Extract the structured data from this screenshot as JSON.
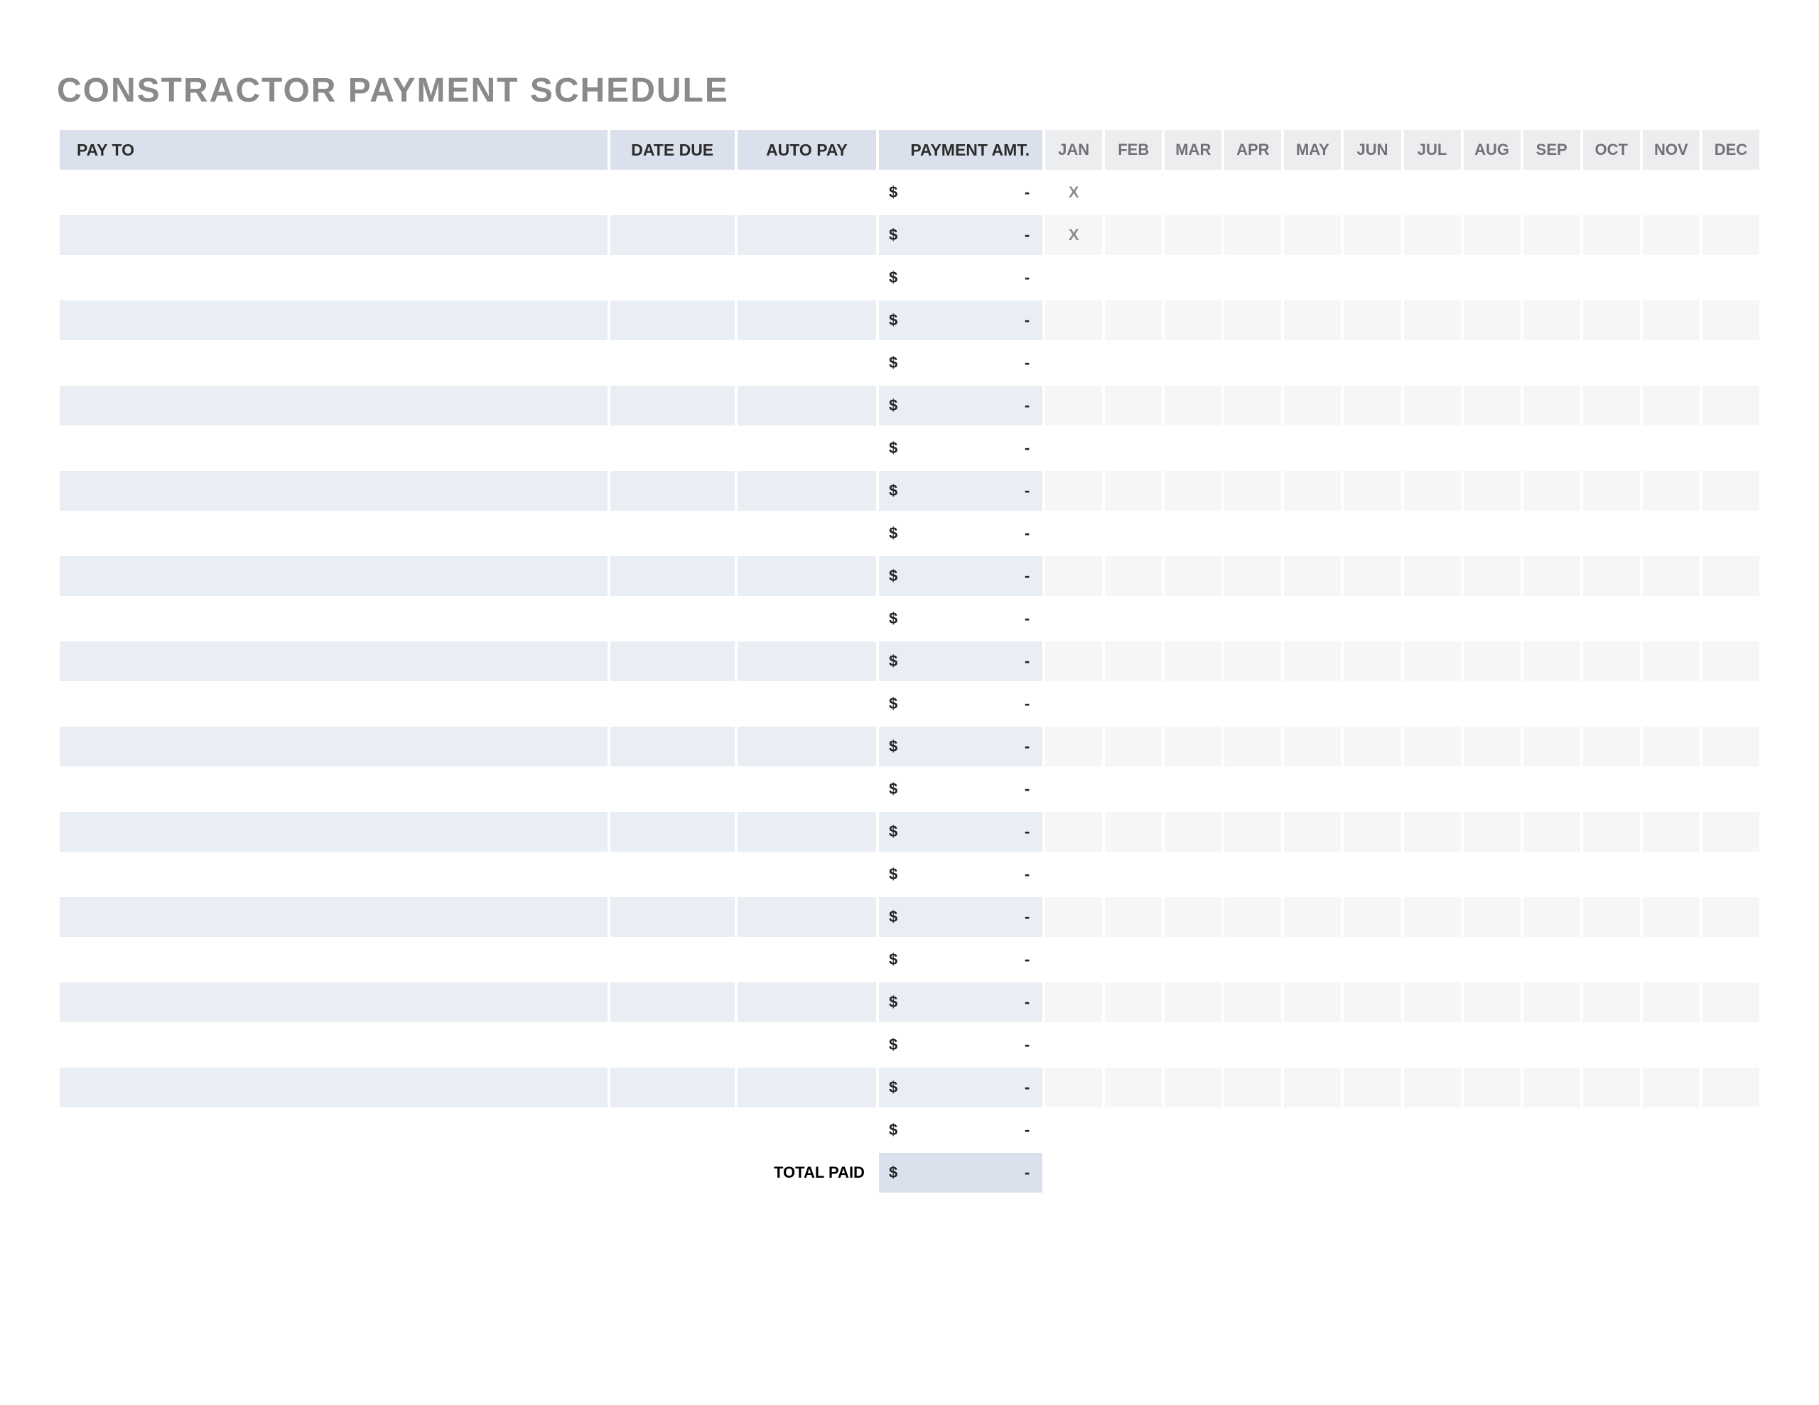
{
  "title": "CONSTRACTOR PAYMENT SCHEDULE",
  "headers": {
    "pay_to": "PAY TO",
    "date_due": "DATE DUE",
    "auto_pay": "AUTO PAY",
    "payment_amt": "PAYMENT AMT."
  },
  "months": [
    "JAN",
    "FEB",
    "MAR",
    "APR",
    "MAY",
    "JUN",
    "JUL",
    "AUG",
    "SEP",
    "OCT",
    "NOV",
    "DEC"
  ],
  "amt_currency": "$",
  "amt_placeholder": "-",
  "month_mark": "X",
  "total_label": "TOTAL PAID",
  "total_currency": "$",
  "total_value": "-",
  "rows": [
    {
      "pay_to": "",
      "date_due": "",
      "auto_pay": "",
      "amt": "-",
      "months": [
        "X",
        "",
        "",
        "",
        "",
        "",
        "",
        "",
        "",
        "",
        "",
        ""
      ]
    },
    {
      "pay_to": "",
      "date_due": "",
      "auto_pay": "",
      "amt": "-",
      "months": [
        "X",
        "",
        "",
        "",
        "",
        "",
        "",
        "",
        "",
        "",
        "",
        ""
      ]
    },
    {
      "pay_to": "",
      "date_due": "",
      "auto_pay": "",
      "amt": "-",
      "months": [
        "",
        "",
        "",
        "",
        "",
        "",
        "",
        "",
        "",
        "",
        "",
        ""
      ]
    },
    {
      "pay_to": "",
      "date_due": "",
      "auto_pay": "",
      "amt": "-",
      "months": [
        "",
        "",
        "",
        "",
        "",
        "",
        "",
        "",
        "",
        "",
        "",
        ""
      ]
    },
    {
      "pay_to": "",
      "date_due": "",
      "auto_pay": "",
      "amt": "-",
      "months": [
        "",
        "",
        "",
        "",
        "",
        "",
        "",
        "",
        "",
        "",
        "",
        ""
      ]
    },
    {
      "pay_to": "",
      "date_due": "",
      "auto_pay": "",
      "amt": "-",
      "months": [
        "",
        "",
        "",
        "",
        "",
        "",
        "",
        "",
        "",
        "",
        "",
        ""
      ]
    },
    {
      "pay_to": "",
      "date_due": "",
      "auto_pay": "",
      "amt": "-",
      "months": [
        "",
        "",
        "",
        "",
        "",
        "",
        "",
        "",
        "",
        "",
        "",
        ""
      ]
    },
    {
      "pay_to": "",
      "date_due": "",
      "auto_pay": "",
      "amt": "-",
      "months": [
        "",
        "",
        "",
        "",
        "",
        "",
        "",
        "",
        "",
        "",
        "",
        ""
      ]
    },
    {
      "pay_to": "",
      "date_due": "",
      "auto_pay": "",
      "amt": "-",
      "months": [
        "",
        "",
        "",
        "",
        "",
        "",
        "",
        "",
        "",
        "",
        "",
        ""
      ]
    },
    {
      "pay_to": "",
      "date_due": "",
      "auto_pay": "",
      "amt": "-",
      "months": [
        "",
        "",
        "",
        "",
        "",
        "",
        "",
        "",
        "",
        "",
        "",
        ""
      ]
    },
    {
      "pay_to": "",
      "date_due": "",
      "auto_pay": "",
      "amt": "-",
      "months": [
        "",
        "",
        "",
        "",
        "",
        "",
        "",
        "",
        "",
        "",
        "",
        ""
      ]
    },
    {
      "pay_to": "",
      "date_due": "",
      "auto_pay": "",
      "amt": "-",
      "months": [
        "",
        "",
        "",
        "",
        "",
        "",
        "",
        "",
        "",
        "",
        "",
        ""
      ]
    },
    {
      "pay_to": "",
      "date_due": "",
      "auto_pay": "",
      "amt": "-",
      "months": [
        "",
        "",
        "",
        "",
        "",
        "",
        "",
        "",
        "",
        "",
        "",
        ""
      ]
    },
    {
      "pay_to": "",
      "date_due": "",
      "auto_pay": "",
      "amt": "-",
      "months": [
        "",
        "",
        "",
        "",
        "",
        "",
        "",
        "",
        "",
        "",
        "",
        ""
      ]
    },
    {
      "pay_to": "",
      "date_due": "",
      "auto_pay": "",
      "amt": "-",
      "months": [
        "",
        "",
        "",
        "",
        "",
        "",
        "",
        "",
        "",
        "",
        "",
        ""
      ]
    },
    {
      "pay_to": "",
      "date_due": "",
      "auto_pay": "",
      "amt": "-",
      "months": [
        "",
        "",
        "",
        "",
        "",
        "",
        "",
        "",
        "",
        "",
        "",
        ""
      ]
    },
    {
      "pay_to": "",
      "date_due": "",
      "auto_pay": "",
      "amt": "-",
      "months": [
        "",
        "",
        "",
        "",
        "",
        "",
        "",
        "",
        "",
        "",
        "",
        ""
      ]
    },
    {
      "pay_to": "",
      "date_due": "",
      "auto_pay": "",
      "amt": "-",
      "months": [
        "",
        "",
        "",
        "",
        "",
        "",
        "",
        "",
        "",
        "",
        "",
        ""
      ]
    },
    {
      "pay_to": "",
      "date_due": "",
      "auto_pay": "",
      "amt": "-",
      "months": [
        "",
        "",
        "",
        "",
        "",
        "",
        "",
        "",
        "",
        "",
        "",
        ""
      ]
    },
    {
      "pay_to": "",
      "date_due": "",
      "auto_pay": "",
      "amt": "-",
      "months": [
        "",
        "",
        "",
        "",
        "",
        "",
        "",
        "",
        "",
        "",
        "",
        ""
      ]
    },
    {
      "pay_to": "",
      "date_due": "",
      "auto_pay": "",
      "amt": "-",
      "months": [
        "",
        "",
        "",
        "",
        "",
        "",
        "",
        "",
        "",
        "",
        "",
        ""
      ]
    },
    {
      "pay_to": "",
      "date_due": "",
      "auto_pay": "",
      "amt": "-",
      "months": [
        "",
        "",
        "",
        "",
        "",
        "",
        "",
        "",
        "",
        "",
        "",
        ""
      ]
    },
    {
      "pay_to": "",
      "date_due": "",
      "auto_pay": "",
      "amt": "-",
      "months": [
        "",
        "",
        "",
        "",
        "",
        "",
        "",
        "",
        "",
        "",
        "",
        ""
      ]
    }
  ]
}
